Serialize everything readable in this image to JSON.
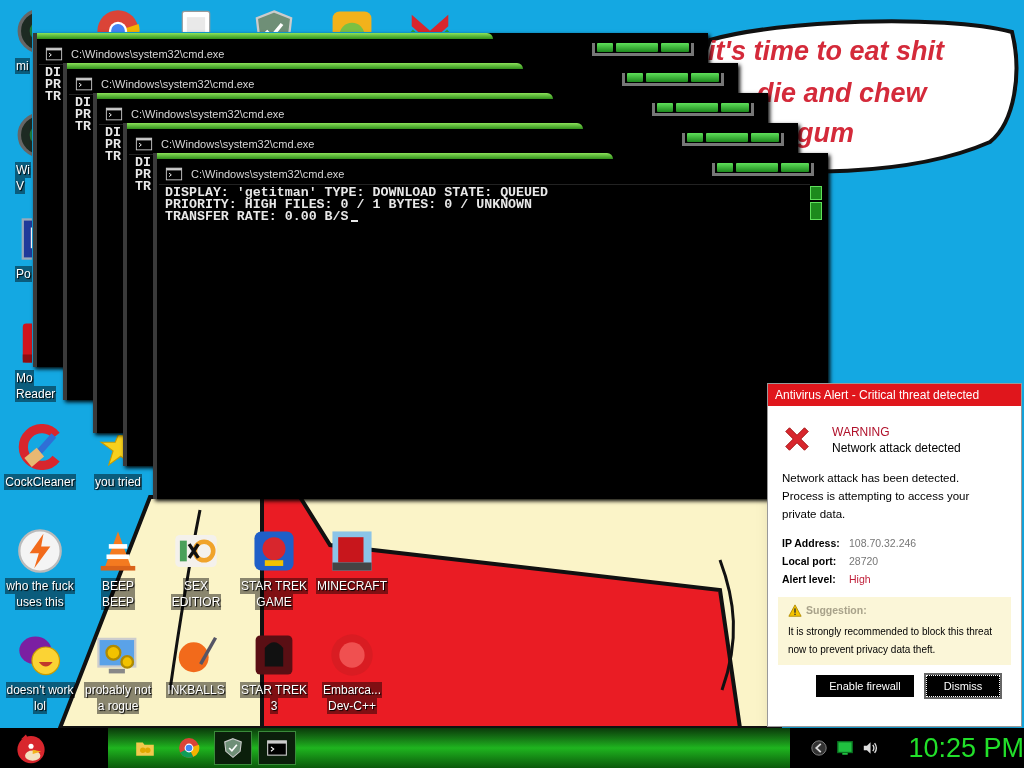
{
  "desktop_icons": [
    {
      "kind": "disc",
      "label_lines": [
        "mi"
      ]
    },
    {
      "kind": "chrome"
    },
    {
      "kind": "cards"
    },
    {
      "kind": "shield"
    },
    {
      "kind": "pig"
    },
    {
      "kind": "flag"
    },
    {
      "kind": "disc",
      "label_lines": [
        "Wi",
        "V"
      ]
    },
    {
      "kind": "document",
      "label_lines": [
        "Po"
      ]
    },
    {
      "kind": "red-app",
      "label_lines": [
        "Mo",
        "Reader"
      ]
    },
    {
      "kind": "cleaner",
      "label_lines": [
        "CockCleaner"
      ]
    },
    {
      "kind": "star",
      "label_lines": [
        "you tried"
      ]
    },
    {
      "kind": "bolt",
      "label_lines": [
        "who the fuck",
        "uses this"
      ]
    },
    {
      "kind": "cone",
      "label_lines": [
        "BEEP",
        "BEEP"
      ]
    },
    {
      "kind": "hex",
      "label_lines": [
        "SEX",
        "EDITIOR"
      ]
    },
    {
      "kind": "badge",
      "label_lines": [
        "STAR TREK",
        "GAME"
      ]
    },
    {
      "kind": "block",
      "label_lines": [
        "MINECRAFT"
      ]
    },
    {
      "kind": "messenger",
      "label_lines": [
        "doesn't work",
        "lol"
      ]
    },
    {
      "kind": "gears",
      "label_lines": [
        "probably not",
        "a rogue"
      ]
    },
    {
      "kind": "ball",
      "label_lines": [
        "INKBALLS"
      ]
    },
    {
      "kind": "helmet",
      "label_lines": [
        "STAR TREK",
        "3"
      ]
    },
    {
      "kind": "dev",
      "label_lines": [
        "Embarca...",
        "Dev-C++"
      ]
    }
  ],
  "speech_bubble": {
    "lines": [
      "it's time to eat shit",
      "die and chew",
      "gum"
    ]
  },
  "windows": [
    {
      "title": "C:\\Windows\\system32\\cmd.exe",
      "lines": [
        "DI",
        "PR",
        "TR"
      ]
    },
    {
      "title": "C:\\Windows\\system32\\cmd.exe",
      "lines": [
        "DI",
        "PR",
        "TR"
      ]
    },
    {
      "title": "C:\\Windows\\system32\\cmd.exe",
      "lines": [
        "DI",
        "PR",
        "TR"
      ]
    },
    {
      "title": "C:\\Windows\\system32\\cmd.exe",
      "lines": [
        "DI",
        "PR",
        "TR"
      ]
    },
    {
      "title": "C:\\Windows\\system32\\cmd.exe",
      "lines": [
        "DISPLAY: 'getitman' TYPE: DOWNLOAD STATE: QUEUED",
        "PRIORITY: HIGH FILES: 0 / 1 BYTES: 0 / UNKNOWN",
        "TRANSFER RATE: 0.00 B/S"
      ],
      "cursor": true
    }
  ],
  "alert": {
    "title": "Antivirus Alert - Critical threat detected",
    "heading": "WARNING",
    "subheading": "Network attack detected",
    "message": "Network attack has been detected. Process is attempting to access your private data.",
    "fields": [
      {
        "label": "IP Address:",
        "value": "108.70.32.246",
        "highlight": false
      },
      {
        "label": "Local port:",
        "value": "28720",
        "highlight": false
      },
      {
        "label": "Alert level:",
        "value": "High",
        "highlight": true
      }
    ],
    "suggestion": {
      "title": "Suggestion:",
      "text": "It is strongly recommended to block this threat now to prevent privacy data theft."
    },
    "buttons": [
      {
        "label": "Enable firewall",
        "focused": false
      },
      {
        "label": "Dismiss",
        "focused": true
      }
    ]
  },
  "taskbar": {
    "pinned": [
      {
        "kind": "folder",
        "active": false
      },
      {
        "kind": "chrome",
        "active": false
      },
      {
        "kind": "shield",
        "active": true
      },
      {
        "kind": "console",
        "active": true
      }
    ],
    "tray": [
      {
        "kind": "arrow"
      },
      {
        "kind": "monitor"
      },
      {
        "kind": "speaker"
      }
    ],
    "clock": "10:25 PM"
  }
}
